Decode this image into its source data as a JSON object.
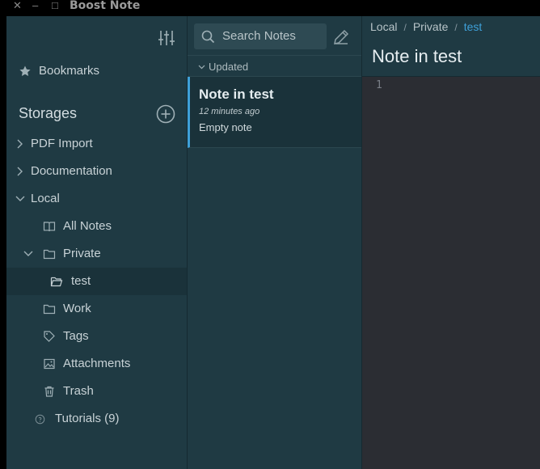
{
  "window": {
    "title": "Boost Note",
    "close_glyph": "✕",
    "minimize_glyph": "–",
    "maximize_glyph": "□"
  },
  "sidebar": {
    "bookmarks_label": "Bookmarks",
    "storages_title": "Storages",
    "storages": [
      {
        "label": "PDF Import"
      },
      {
        "label": "Documentation"
      },
      {
        "label": "Local"
      }
    ],
    "local_items": {
      "all_notes": "All Notes",
      "private": "Private",
      "test": "test",
      "work": "Work",
      "tags": "Tags",
      "attachments": "Attachments",
      "trash": "Trash"
    },
    "tutorials_label": "Tutorials (9)"
  },
  "note_list": {
    "search_placeholder": "Search Notes",
    "sort_label": "Updated",
    "notes": [
      {
        "title": "Note in test",
        "date": "12 minutes ago",
        "preview": "Empty note"
      }
    ]
  },
  "editor": {
    "breadcrumbs": [
      "Local",
      "Private",
      "test"
    ],
    "title": "Note in test",
    "line_number": "1"
  },
  "colors": {
    "sidebar_bg": "#1f3a43",
    "editor_bg": "#2b2d33",
    "accent": "#3ea0d8"
  }
}
